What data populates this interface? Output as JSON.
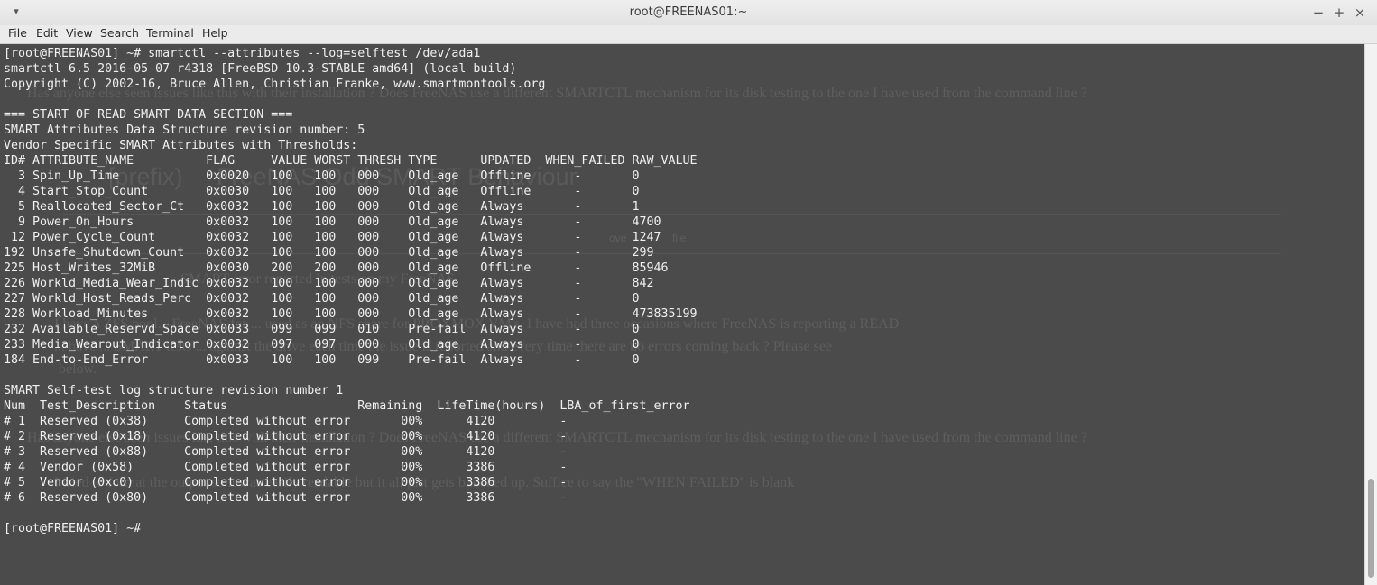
{
  "window": {
    "title": "root@FREENAS01:~",
    "menu_icon": "chevron-down-icon",
    "controls": {
      "minimize": "−",
      "maximize": "+",
      "close": "×"
    }
  },
  "menu": {
    "items": [
      "File",
      "Edit",
      "View",
      "Search",
      "Terminal",
      "Help"
    ]
  },
  "terminal": {
    "lines": [
      "[root@FREENAS01] ~# smartctl --attributes --log=selftest /dev/ada1",
      "smartctl 6.5 2016-05-07 r4318 [FreeBSD 10.3-STABLE amd64] (local build)",
      "Copyright (C) 2002-16, Bruce Allen, Christian Franke, www.smartmontools.org",
      "",
      "=== START OF READ SMART DATA SECTION ===",
      "SMART Attributes Data Structure revision number: 5",
      "Vendor Specific SMART Attributes with Thresholds:",
      "ID# ATTRIBUTE_NAME          FLAG     VALUE WORST THRESH TYPE      UPDATED  WHEN_FAILED RAW_VALUE",
      "  3 Spin_Up_Time            0x0020   100   100   000    Old_age   Offline      -       0",
      "  4 Start_Stop_Count        0x0030   100   100   000    Old_age   Offline      -       0",
      "  5 Reallocated_Sector_Ct   0x0032   100   100   000    Old_age   Always       -       1",
      "  9 Power_On_Hours          0x0032   100   100   000    Old_age   Always       -       4700",
      " 12 Power_Cycle_Count       0x0032   100   100   000    Old_age   Always       -       1247",
      "192 Unsafe_Shutdown_Count   0x0032   100   100   000    Old_age   Always       -       299",
      "225 Host_Writes_32MiB       0x0030   200   200   000    Old_age   Offline      -       85946",
      "226 Workld_Media_Wear_Indic 0x0032   100   100   000    Old_age   Always       -       842",
      "227 Workld_Host_Reads_Perc  0x0032   100   100   000    Old_age   Always       -       0",
      "228 Workload_Minutes        0x0032   100   100   000    Old_age   Always       -       473835199",
      "232 Available_Reservd_Space 0x0033   099   099   010    Pre-fail  Always       -       0",
      "233 Media_Wearout_Indicator 0x0032   097   097   000    Old_age   Always       -       0",
      "184 End-to-End_Error        0x0033   100   100   099    Pre-fail  Always       -       0",
      "",
      "SMART Self-test log structure revision number 1",
      "Num  Test_Description    Status                  Remaining  LifeTime(hours)  LBA_of_first_error",
      "# 1  Reserved (0x38)     Completed without error       00%      4120         -",
      "# 2  Reserved (0x18)     Completed without error       00%      4120         -",
      "# 3  Reserved (0x88)     Completed without error       00%      4120         -",
      "# 4  Vendor (0x58)       Completed without error       00%      3386         -",
      "# 5  Vendor (0xc0)       Completed without error       00%      3386         -",
      "# 6  Reserved (0x80)     Completed without error       00%      3386         -",
      "",
      "[root@FREENAS01] ~# "
    ]
  },
  "background_page": {
    "line_1": "Has anyone else seen issues like this with their installation ? Does FreeNAS use a different SMARTCTL mechanism for its disk testing to the one I have used from the command line ?",
    "heading_prefix": "[prefix)",
    "heading": "FreeNAS Odd SMART Behaviour",
    "toolbar_words": [
      "ove",
      "file"
    ],
    "line_2": "SMART error reported in tests on my FreeNAS",
    "line_3a": "I have a ZFS pool... FreeNAS for ... used as an NFS share for PROXMOX VM's. I have had three occasions where FreeNAS is reporting a READ",
    "line_3b": "... have ... SMART tests ... against the drive each time the issue is reported and every time there are no errors coming back ? Please see",
    "line_3c": "below.",
    "line_4": "Has anyone else seen issues like this with their installation ? Does FreeNAS use a different SMARTCTL mechanism for its disk testing to the one I have used from the command line ?",
    "line_5": "I tried to format the output so it was easily readable but it all just gets bunched up.  Suffice to say the \"WHEN FAILED\" is blank"
  }
}
